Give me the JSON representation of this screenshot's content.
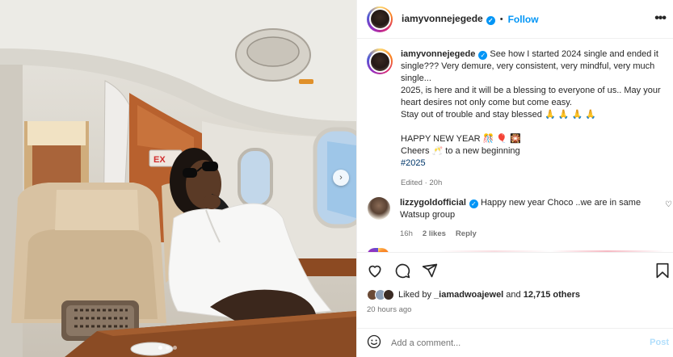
{
  "post": {
    "username": "iamyvonnejegede",
    "separator": "•",
    "follow_label": "Follow",
    "more_label": "•••"
  },
  "caption": {
    "username": "iamyvonnejegede",
    "line1": "See how I started 2024 single and ended it single??? Very demure, very consistent, very mindful, very much single...",
    "line2": "2025, is here and it will be a blessing to everyone of us.. May your heart desires not only come but come easy.",
    "line3": "Stay out of trouble and stay blessed 🙏 🙏 🙏 🙏",
    "line4": "HAPPY NEW YEAR 🎊 🎈 🎇",
    "line5": "Cheers 🥂 to a new beginning",
    "hashtag": "#2025",
    "meta": "Edited · 20h"
  },
  "comment": {
    "username": "lizzygoldofficial",
    "text": "Happy new year Choco ..we are in same Watsup group",
    "time": "16h",
    "likes": "2 likes",
    "reply": "Reply"
  },
  "likes": {
    "prefix": "Liked by ",
    "liker": "_iamadwoajewel",
    "middle": " and ",
    "others": "12,715 others",
    "time_ago": "20 hours ago"
  },
  "add_comment": {
    "placeholder": "Add a comment...",
    "post_label": "Post"
  },
  "photo": {
    "sign_text": "EX",
    "carousel_arrow": "›",
    "carousel_pages": 3,
    "carousel_active": 1
  },
  "colors": {
    "link_blue": "#0095f6",
    "hashtag_blue": "#00376b",
    "muted_gray": "#737373"
  }
}
